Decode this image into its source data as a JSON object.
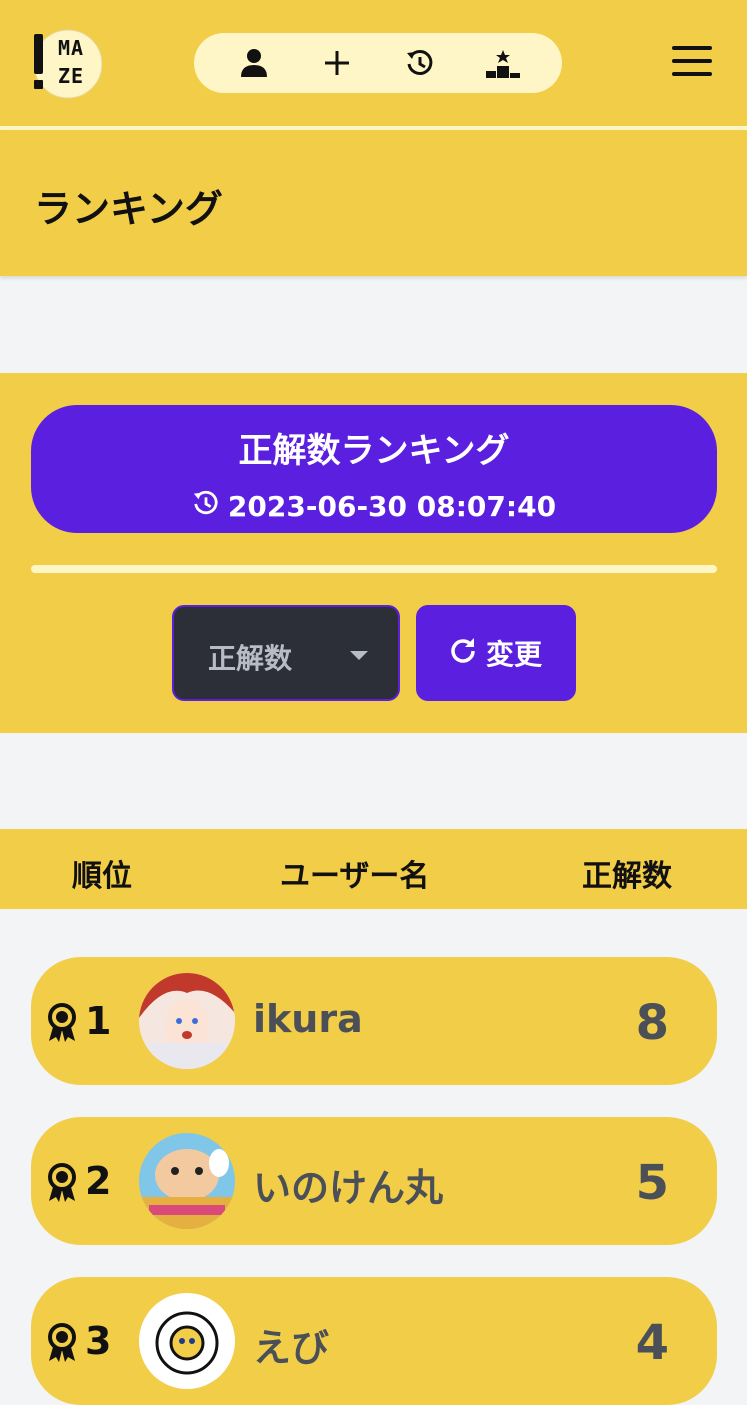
{
  "header": {
    "logo_text_top": "MA",
    "logo_text_bottom": "ZE",
    "nav_icons": [
      "user-icon",
      "plus-icon",
      "history-icon",
      "podium-icon"
    ],
    "menu_icon": "hamburger-icon"
  },
  "page": {
    "title": "ランキング"
  },
  "ranking_card": {
    "title": "正解数ランキング",
    "timestamp": "2023-06-30 08:07:40"
  },
  "controls": {
    "select_value": "正解数",
    "change_label": "変更"
  },
  "table": {
    "headers": [
      "順位",
      "ユーザー名",
      "正解数"
    ],
    "rows": [
      {
        "rank": "1",
        "name": "ikura",
        "score": "8"
      },
      {
        "rank": "2",
        "name": "いのけん丸",
        "score": "5"
      },
      {
        "rank": "3",
        "name": "えび",
        "score": "4"
      }
    ]
  },
  "colors": {
    "brand_yellow": "#f2cd48",
    "accent_purple": "#5b1fdf",
    "pale_yellow": "#fff6c8"
  }
}
